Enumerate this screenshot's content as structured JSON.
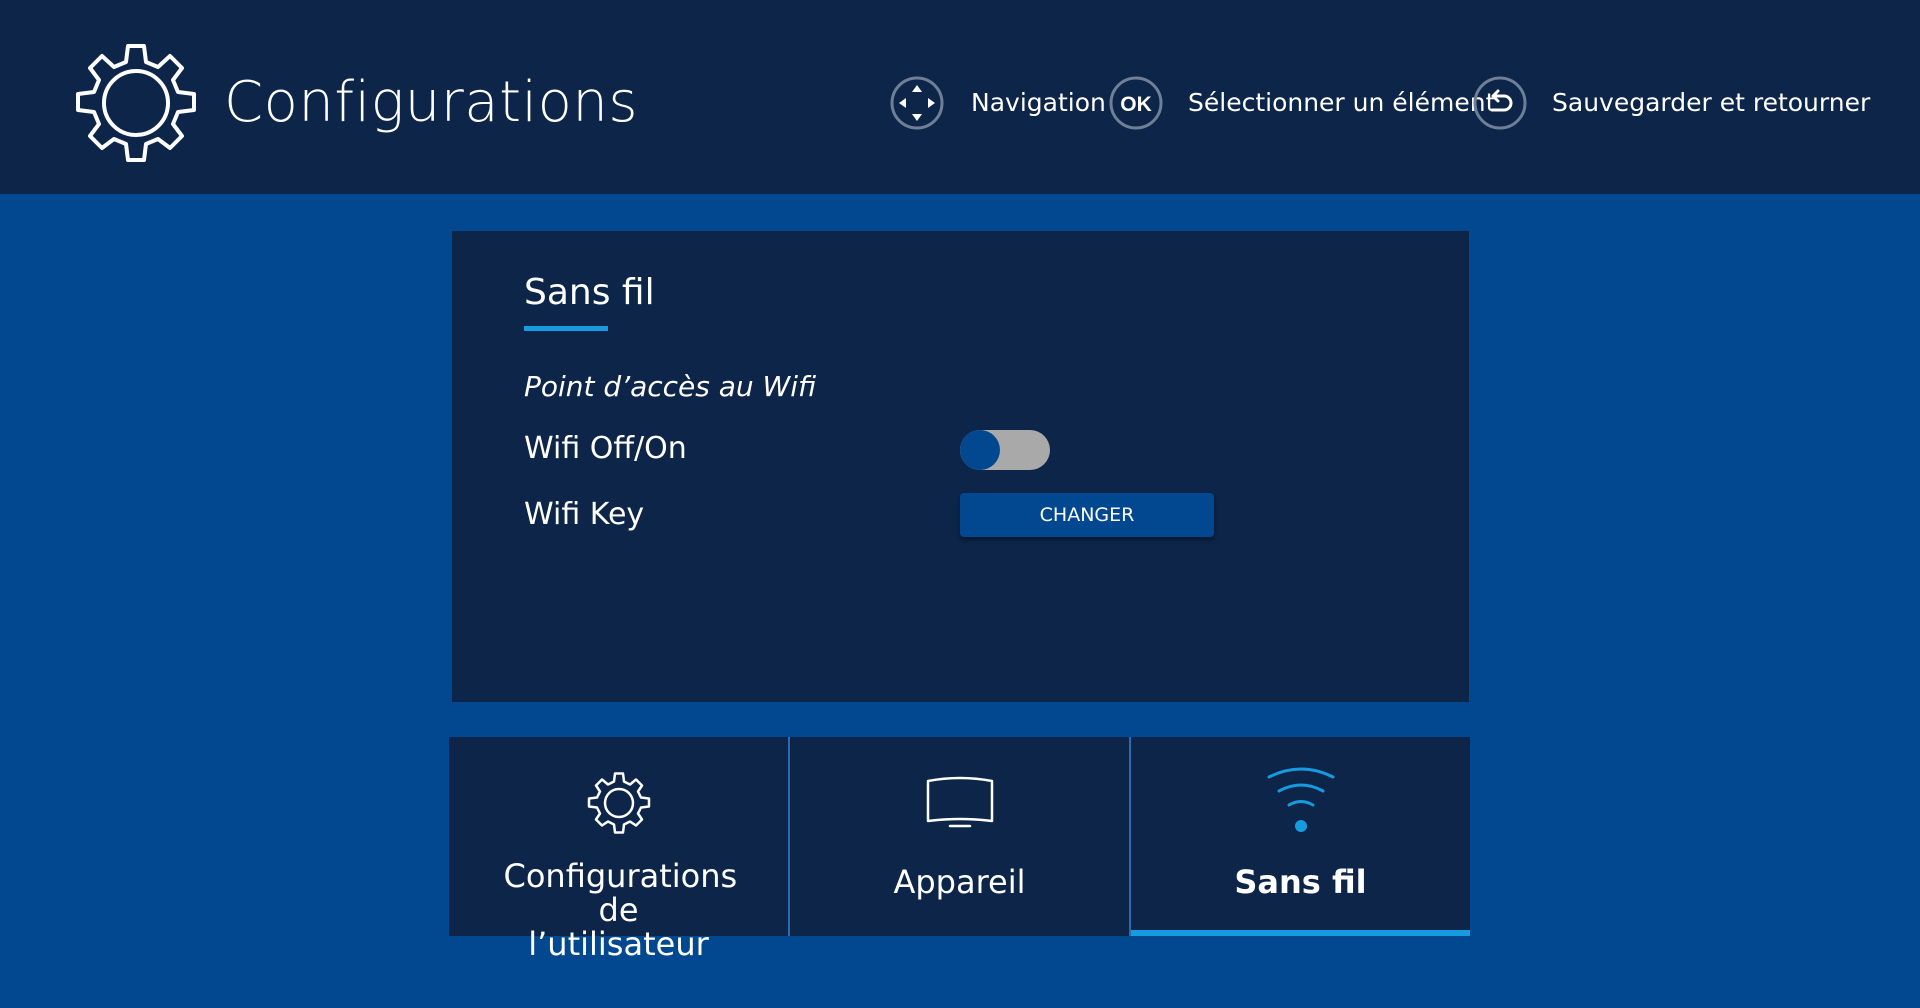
{
  "header": {
    "title": "Configurations",
    "icon": "gear-icon",
    "hints": [
      {
        "icon": "dpad-icon",
        "label": "Navigation"
      },
      {
        "icon": "ok-button-icon",
        "glyph": "OK",
        "label": "Sélectionner un élément"
      },
      {
        "icon": "back-icon",
        "label": "Sauvegarder et retourner"
      }
    ]
  },
  "panel": {
    "title": "Sans fil",
    "section": "Point d’accès au Wifi",
    "rows": [
      {
        "label": "Wifi Off/On",
        "control": "toggle",
        "value": "off"
      },
      {
        "label": "Wifi Key",
        "control": "button",
        "button_label": "CHANGER"
      }
    ]
  },
  "tabs": [
    {
      "label": "Configurations de l’utilisateur",
      "icon": "gear-icon",
      "active": false
    },
    {
      "label": "Appareil",
      "icon": "monitor-icon",
      "active": false
    },
    {
      "label": "Sans fil",
      "icon": "wifi-icon",
      "active": true
    }
  ],
  "colors": {
    "background": "#024890",
    "header": "#0c2548",
    "panel": "#0c2548",
    "accent": "#169be0",
    "button": "#024890",
    "toggle_track": "#a9a9a9"
  }
}
